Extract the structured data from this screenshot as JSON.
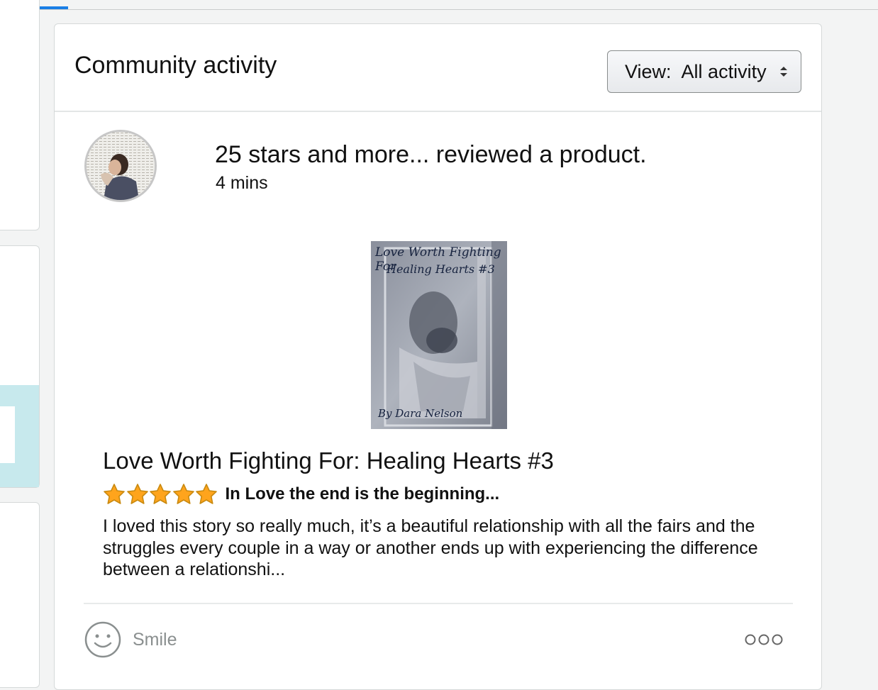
{
  "header": {
    "title": "Community activity",
    "view_label": "View:",
    "view_value": "All activity"
  },
  "activity": {
    "line": "25 stars and more... reviewed a product.",
    "time": "4 mins"
  },
  "product": {
    "cover_title": "Love Worth Fighting For",
    "cover_subtitle": "Healing Hearts #3",
    "cover_author": "By Dara Nelson",
    "title": "Love Worth Fighting For: Healing Hearts #3"
  },
  "review": {
    "rating": 5,
    "rating_max": 5,
    "headline": "In Love the end is the beginning...",
    "body": "I loved this story so really much, it’s a beautiful relationship with all the fairs and the struggles every couple in a way or another ends up with experiencing the difference between a relationshi..."
  },
  "footer": {
    "smile_label": "Smile"
  },
  "icons": {
    "view_chevron": "chevron-updown-icon",
    "smile": "smile-icon",
    "more": "more-options-icon",
    "star": "star-icon"
  },
  "colors": {
    "accent_blue": "#1a7ee6",
    "star_fill": "#ffa41c",
    "side_highlight": "#c7e9ed"
  }
}
